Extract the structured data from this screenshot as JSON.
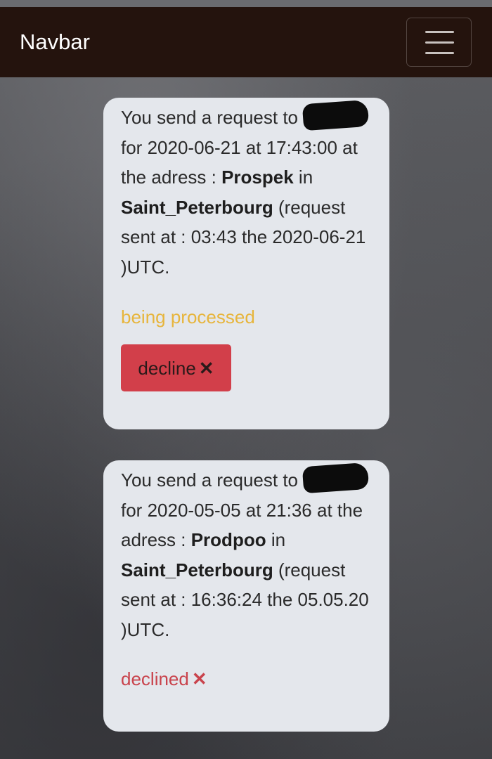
{
  "navbar": {
    "brand": "Navbar",
    "toggler_icon": "hamburger-menu-icon"
  },
  "requests": [
    {
      "intro": "You send a request to",
      "for_text": " for 2020-06-21 at 17:43:00 at the adress : ",
      "place": "Prospek",
      "in_text": " in ",
      "city": "Saint_Peterbourg",
      "sent_text": " (request sent at : 03:43 the 2020-06-21 )UTC.",
      "status": "being processed",
      "action_label": "decline",
      "action_icon": "close-icon"
    },
    {
      "intro": "You send a request to",
      "for_text": " for 2020-05-05 at 21:36 at the adress : ",
      "place": "Prodpoo",
      "in_text": " in ",
      "city": "Saint_Peterbourg",
      "sent_text": " (request sent at : 16:36:24 the 05.05.20 )UTC.",
      "status": "declined",
      "status_icon": "close-icon"
    }
  ],
  "colors": {
    "navbar_bg": "#24130d",
    "card_bg": "#e4e7ec",
    "processing": "#e7b53c",
    "declined": "#c9434c",
    "decline_button": "#d23f4a"
  }
}
